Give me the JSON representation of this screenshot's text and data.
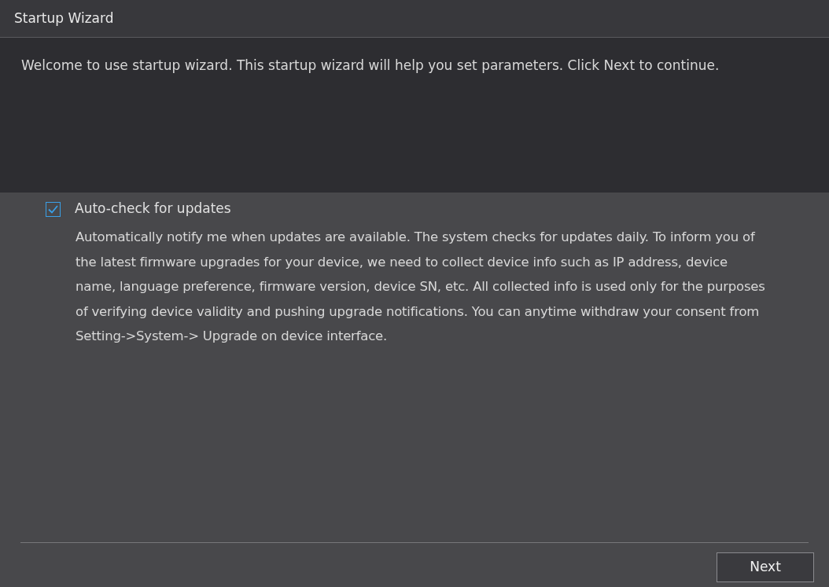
{
  "window": {
    "title": "Startup Wizard"
  },
  "welcome": "Welcome to use startup wizard. This startup wizard will help you set parameters. Click Next to continue.",
  "auto_check": {
    "label": "Auto-check for updates",
    "checked": true,
    "description": "Automatically notify me when updates are available. The system checks for updates daily. To inform you of the latest firmware upgrades for your device, we need to collect device info such as IP address, device name, language preference, firmware version, device SN, etc. All collected info is used only for the purposes of verifying device validity and pushing upgrade notifications. You can anytime withdraw your consent from Setting->System-> Upgrade on device interface."
  },
  "buttons": [
    "Next"
  ]
}
